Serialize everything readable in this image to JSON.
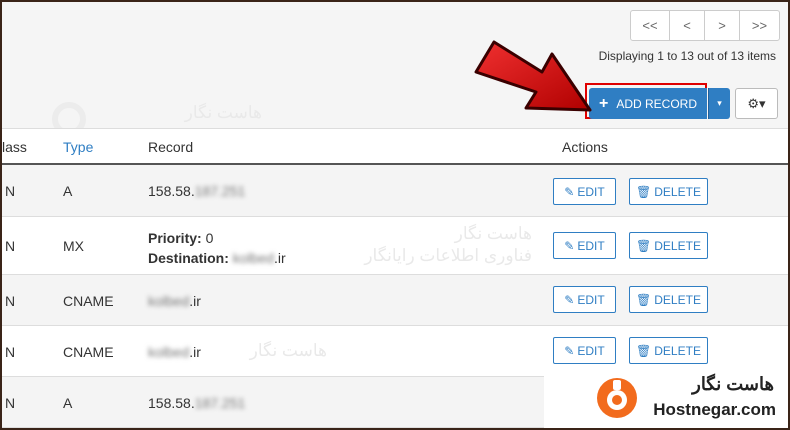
{
  "pagination": {
    "first": "<<",
    "prev": "<",
    "next": ">",
    "last": ">>",
    "status": "Displaying 1 to 13 out of 13 items"
  },
  "toolbar": {
    "add_label": "ADD RECORD",
    "add_icon": "+",
    "caret": "▾",
    "gear": "⚙▾"
  },
  "table": {
    "headers": {
      "class": "lass",
      "type": "Type",
      "record": "Record",
      "actions": "Actions"
    },
    "rows": [
      {
        "class": "N",
        "type": "A",
        "record_prefix": "158.58.",
        "record_blur": "187.251"
      },
      {
        "class": "N",
        "type": "MX",
        "priority_label": "Priority:",
        "priority_value": "0",
        "dest_label": "Destination:",
        "dest_blur": "kolbed",
        "dest_suffix": ".ir"
      },
      {
        "class": "N",
        "type": "CNAME",
        "record_blur": "kolbed",
        "record_suffix": ".ir"
      },
      {
        "class": "N",
        "type": "CNAME",
        "record_blur": "kolbed",
        "record_suffix": ".ir"
      },
      {
        "class": "N",
        "type": "A",
        "record_prefix": "158.58.",
        "record_blur": "187.251"
      }
    ],
    "edit_label": "EDIT",
    "delete_label": "DELETE"
  },
  "watermark": {
    "line1": "هاست نگار",
    "line2": "فناوری اطلاعات رایانگار"
  },
  "brand": {
    "fa": "هاست نگار",
    "en": "Hostnegar.com"
  },
  "colors": {
    "primary": "#2f7ec3",
    "highlight": "#e00000",
    "arrow": "#d81515",
    "brand_orange": "#f26b1d"
  }
}
